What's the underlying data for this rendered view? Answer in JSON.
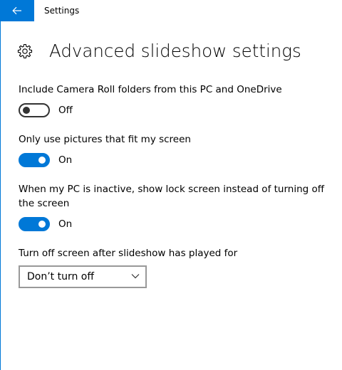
{
  "window": {
    "title": "Settings"
  },
  "page": {
    "title": "Advanced slideshow settings"
  },
  "settings": [
    {
      "label": "Include Camera Roll folders from this PC and OneDrive",
      "state": "Off",
      "on": false
    },
    {
      "label": "Only use pictures that fit my screen",
      "state": "On",
      "on": true
    },
    {
      "label": "When my PC is inactive, show lock screen instead of turning off the screen",
      "state": "On",
      "on": true
    }
  ],
  "screen_off": {
    "label": "Turn off screen after slideshow has played for",
    "selected": "Don’t turn off"
  },
  "icons": {
    "back": "back-arrow-icon",
    "gear": "gear-icon",
    "chevron": "chevron-down-icon"
  },
  "colors": {
    "accent": "#0078d7",
    "toggle_off_border": "#333333",
    "dropdown_border": "#999999"
  }
}
